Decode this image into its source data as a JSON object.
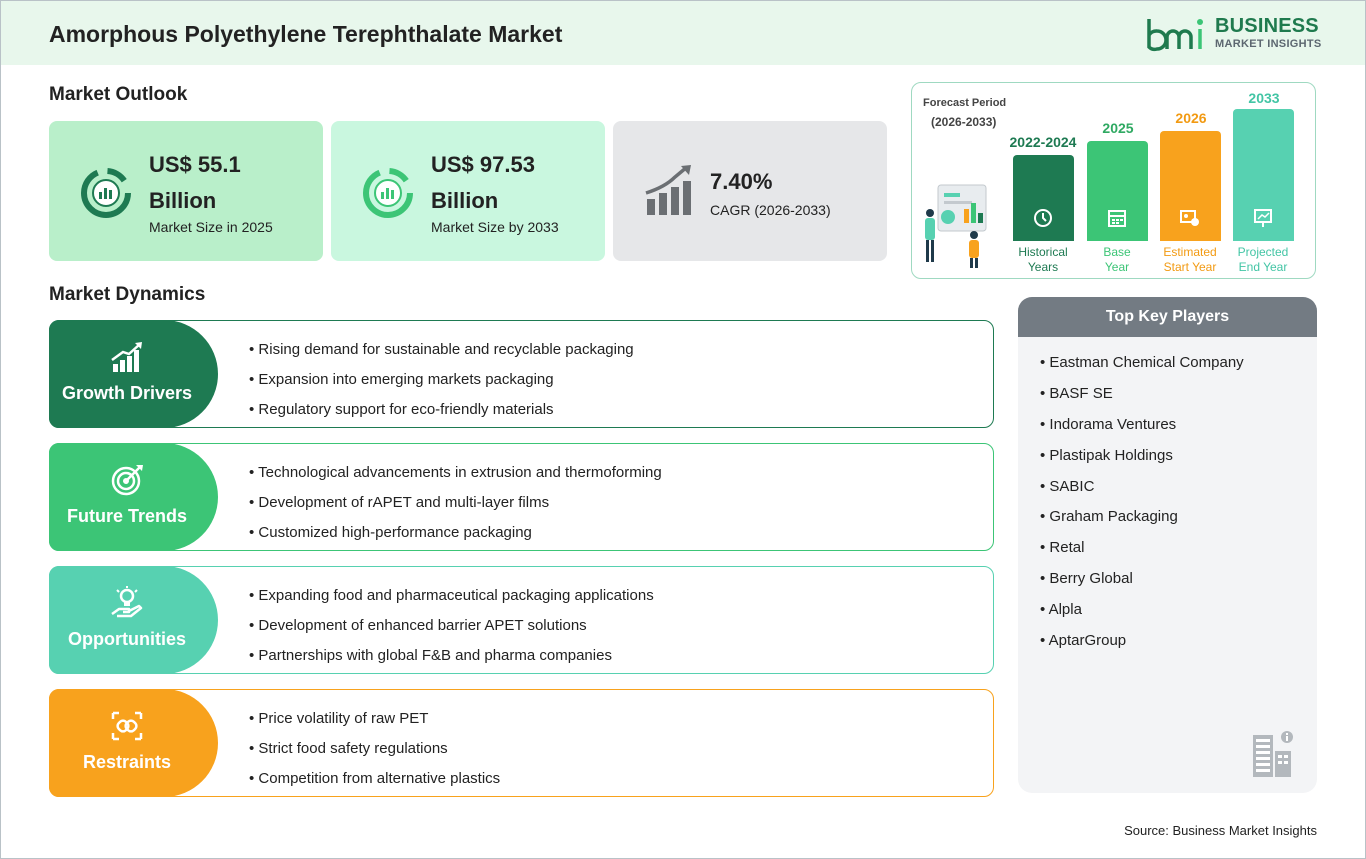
{
  "header": {
    "title": "Amorphous Polyethylene Terephthalate Market",
    "logo_line1": "BUSINESS",
    "logo_line2": "MARKET INSIGHTS"
  },
  "outlook": {
    "title": "Market Outlook",
    "cards": [
      {
        "value": "US$ 55.1 Billion",
        "label": "Market Size in 2025",
        "color": "#b9efca",
        "icon": "pie-chart-icon"
      },
      {
        "value": "US$ 97.53 Billion",
        "label": "Market Size by 2033",
        "color": "#c9f7df",
        "icon": "pie-chart-icon"
      },
      {
        "value": "7.40%",
        "label": "CAGR (2026-2033)",
        "color": "#e6e7e9",
        "icon": "growth-chart-icon"
      }
    ]
  },
  "forecast": {
    "label": "Forecast Period",
    "range": "(2026-2033)",
    "bars": [
      {
        "year": "2022-2024",
        "sub1": "Historical",
        "sub2": "Years",
        "color": "#1e7a52",
        "year_color": "#1e7a52",
        "sub_color": "#1e7a52",
        "icon": "history-icon"
      },
      {
        "year": "2025",
        "sub1": "Base",
        "sub2": "Year",
        "color": "#3cc576",
        "year_color": "#2fa962",
        "sub_color": "#3cc576",
        "icon": "calendar-icon"
      },
      {
        "year": "2026",
        "sub1": "Estimated",
        "sub2": "Start Year",
        "color": "#f8a21d",
        "year_color": "#f29a12",
        "sub_color": "#f29a12",
        "icon": "estimate-icon"
      },
      {
        "year": "2033",
        "sub1": "Projected",
        "sub2": "End Year",
        "color": "#57d1b1",
        "year_color": "#43c5a5",
        "sub_color": "#43c5a5",
        "icon": "projection-icon"
      }
    ]
  },
  "dynamics": {
    "title": "Market Dynamics",
    "rows": [
      {
        "title": "Growth Drivers",
        "color": "#1e7a52",
        "icon": "growth-bars-icon",
        "items": [
          "Rising demand for sustainable and recyclable packaging",
          "Expansion into emerging markets packaging",
          "Regulatory support for eco-friendly materials"
        ]
      },
      {
        "title": "Future Trends",
        "color": "#3cc576",
        "icon": "target-icon",
        "items": [
          "Technological advancements in extrusion and thermoforming",
          "Development of rAPET and multi-layer films",
          "Customized high-performance packaging"
        ]
      },
      {
        "title": "Opportunities",
        "color": "#57d1b1",
        "icon": "lightbulb-hand-icon",
        "items": [
          "Expanding food and pharmaceutical packaging applications",
          "Development of enhanced barrier APET solutions",
          "Partnerships with global F&B and pharma companies"
        ]
      },
      {
        "title": "Restraints",
        "color": "#f8a21d",
        "icon": "broken-link-icon",
        "items": [
          "Price volatility of raw PET",
          "Strict food safety regulations",
          "Competition from alternative plastics"
        ]
      }
    ]
  },
  "players": {
    "title": "Top Key Players",
    "items": [
      "Eastman Chemical Company",
      "BASF SE",
      "Indorama Ventures",
      "Plastipak Holdings",
      "SABIC",
      "Graham Packaging",
      "Retal",
      "Berry Global",
      "Alpla",
      "AptarGroup"
    ]
  },
  "source": "Source: Business Market Insights"
}
